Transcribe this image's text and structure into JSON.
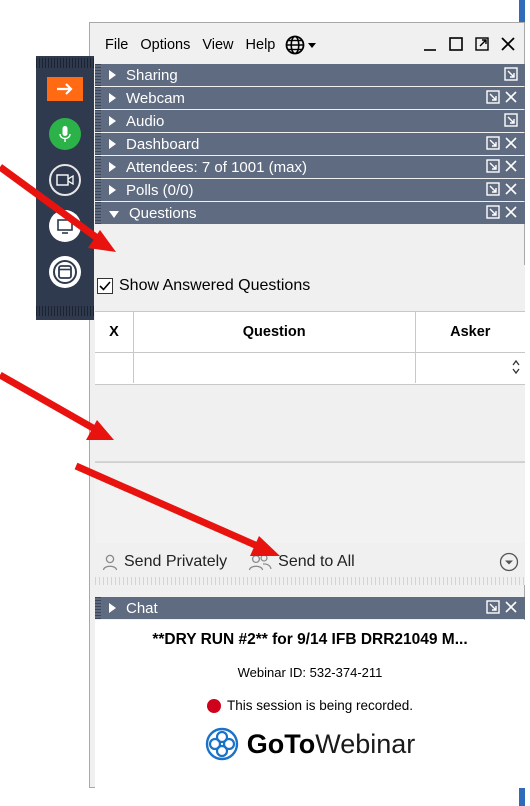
{
  "menu": {
    "items": [
      "File",
      "Options",
      "View",
      "Help"
    ]
  },
  "sections": [
    {
      "label": "Sharing"
    },
    {
      "label": "Webcam"
    },
    {
      "label": "Audio"
    },
    {
      "label": "Dashboard"
    },
    {
      "label": "Attendees: 7 of 1001 (max)"
    },
    {
      "label": "Polls (0/0)"
    },
    {
      "label": "Questions"
    }
  ],
  "questions": {
    "show_answered": "Show Answered Questions",
    "columns": {
      "x": "X",
      "question": "Question",
      "asker": "Asker"
    },
    "send_privately": "Send Privately",
    "send_to_all": "Send to All"
  },
  "chat": {
    "header": "Chat",
    "webinar_title": "**DRY RUN #2** for 9/14 IFB DRR21049 M...",
    "webinar_id": "Webinar ID: 532-374-211",
    "recording": "This session is being recorded.",
    "brand_goto": "GoTo",
    "brand_webinar": "Webinar"
  },
  "colors": {
    "section_header": "#5f6b80",
    "toolbar": "#2f3a4e",
    "accent_orange": "#ff6a13",
    "mic_green": "#2bb34a",
    "record_red": "#d0021b",
    "arrow_red": "#e8130e",
    "brand_blue": "#1a73c9"
  }
}
